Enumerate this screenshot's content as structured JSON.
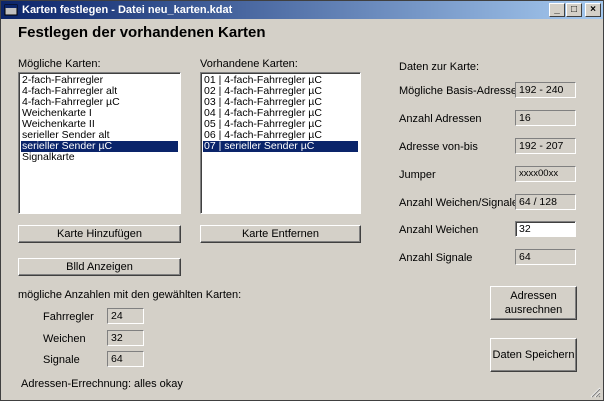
{
  "window": {
    "title": "Karten festlegen - Datei neu_karten.kdat",
    "controls": [
      "_",
      "□",
      "×"
    ]
  },
  "heading": "Festlegen der vorhandenen Karten",
  "possible": {
    "label": "Mögliche Karten:",
    "items": [
      "2-fach-Fahrregler",
      "4-fach-Fahrregler alt",
      "4-fach-Fahrregler µC",
      "Weichenkarte I",
      "Weichenkarte II",
      "serieller Sender alt",
      "serieller Sender µC",
      "Signalkarte"
    ],
    "selected_index": 6,
    "add_button": "Karte Hinzufügen",
    "image_button": "Blld Anzeigen"
  },
  "present": {
    "label": "Vorhandene Karten:",
    "items": [
      "01 | 4-fach-Fahrregler µC",
      "02 | 4-fach-Fahrregler µC",
      "03 | 4-fach-Fahrregler µC",
      "04 | 4-fach-Fahrregler µC",
      "05 | 4-fach-Fahrregler µC",
      "06 | 4-fach-Fahrregler µC",
      "07 | serieller Sender µC"
    ],
    "selected_index": 6,
    "remove_button": "Karte Entfernen"
  },
  "card_info": {
    "label": "Daten zur Karte:",
    "base_addresses_label": "Mögliche Basis-Adressen",
    "base_addresses": "192 - 240",
    "address_count_label": "Anzahl Adressen",
    "address_count": "16",
    "address_range_label": "Adresse von-bis",
    "address_range": "192 - 207",
    "jumper_label": "Jumper",
    "jumper": "xxxx00xx",
    "switch_signal_label": "Anzahl Weichen/Signale",
    "switch_signal": "64 / 128",
    "switches_label": "Anzahl Weichen",
    "switches": "32",
    "signals_label": "Anzahl Signale",
    "signals": "64"
  },
  "possible_counts": {
    "label": "mögliche Anzahlen mit den gewählten Karten:",
    "drive_label": "Fahrregler",
    "drive": "24",
    "switches_label": "Weichen",
    "switches": "32",
    "signals_label": "Signale",
    "signals": "64"
  },
  "calc": {
    "label": "Adressen-Errechnung:",
    "status": "alles okay"
  },
  "buttons": {
    "compute": "Adressen\nausrechnen",
    "save": "Daten Speichern"
  }
}
